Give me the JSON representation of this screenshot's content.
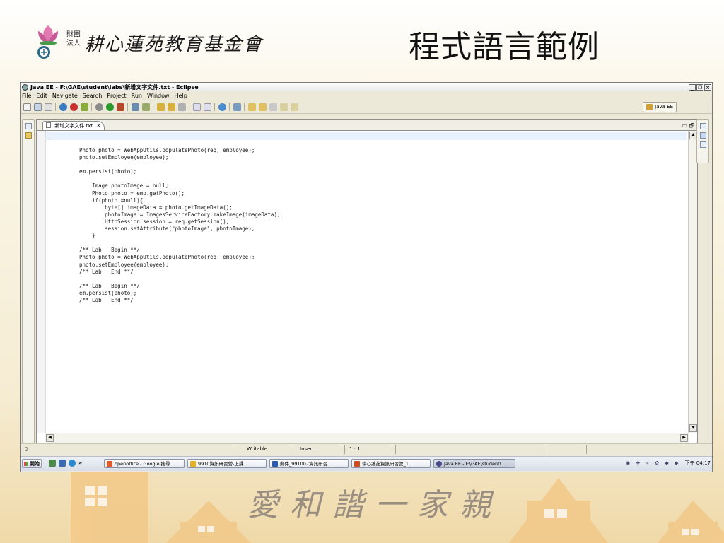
{
  "slide": {
    "logo_small": "財團法人",
    "logo_name": "耕心蓮苑教育基金會",
    "title": "程式語言範例",
    "motto": "愛和諧一家親"
  },
  "window": {
    "title": "Java EE - F:\\GAE\\student\\labs\\新增文字文件.txt - Eclipse",
    "controls": [
      "_",
      "❐",
      "×"
    ]
  },
  "menu": [
    "File",
    "Edit",
    "Navigate",
    "Search",
    "Project",
    "Run",
    "Window",
    "Help"
  ],
  "perspective": {
    "label": "Java EE"
  },
  "editor": {
    "tab_label": "新增文字文件.txt",
    "tab_close": "✕",
    "tab_controls": "▭ 🗗",
    "lines": [
      "Photo photo = WebAppUtils.populatePhoto(req, employee);",
      "photo.setEmployee(employee);",
      "",
      "em.persist(photo);",
      "",
      "    Image photoImage = null;",
      "    Photo photo = emp.getPhoto();",
      "    if(photo!=null){",
      "        byte[] imageData = photo.getImageData();",
      "        photoImage = ImagesServiceFactory.makeImage(imageData);",
      "        HttpSession session = req.getSession();",
      "        session.setAttribute(\"photoImage\", photoImage);",
      "    }",
      "",
      "/** Lab   Begin **/",
      "Photo photo = WebAppUtils.populatePhoto(req, employee);",
      "photo.setEmployee(employee);",
      "/** Lab   End **/",
      "",
      "/** Lab   Begin **/",
      "em.persist(photo);",
      "/** Lab   End **/"
    ]
  },
  "status": {
    "mode": "Writable",
    "insert": "Insert",
    "position": "1 : 1"
  },
  "taskbar": {
    "start": "開始",
    "tasks": [
      {
        "label": "openoffice - Google 搜尋...",
        "color": "#e05a2a"
      },
      {
        "label": "9910資訊研習營-上課...",
        "color": "#e8b020"
      },
      {
        "label": "郵件_991007資訊研習...",
        "color": "#2a5ab8"
      },
      {
        "label": "耕心蓮苑資訊研習營_1...",
        "color": "#d04a20"
      },
      {
        "label": "Java EE - F:\\GAE\\student\\...",
        "color": "#4a4a8a"
      }
    ],
    "clock": "下午 04:17"
  }
}
